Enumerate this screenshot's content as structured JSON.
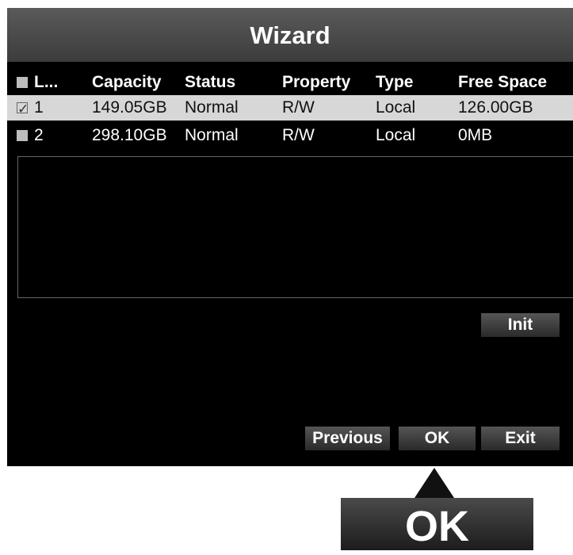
{
  "window": {
    "title": "Wizard"
  },
  "table": {
    "headers": [
      "L...",
      "Capacity",
      "Status",
      "Property",
      "Type",
      "Free Space"
    ],
    "rows": [
      {
        "label": "1",
        "capacity": "149.05GB",
        "status": "Normal",
        "property": "R/W",
        "type": "Local",
        "free_space": "126.00GB",
        "checked": true,
        "selected": true
      },
      {
        "label": "2",
        "capacity": "298.10GB",
        "status": "Normal",
        "property": "R/W",
        "type": "Local",
        "free_space": "0MB",
        "checked": false,
        "selected": false
      }
    ]
  },
  "buttons": {
    "init": "Init",
    "previous": "Previous",
    "ok": "OK",
    "exit": "Exit"
  },
  "callout": {
    "label": "OK"
  },
  "icons": {
    "row_checkbox": "checkbox-icon",
    "checkmark": "checkmark-icon"
  },
  "colors": {
    "selected_row": "#d7d7d7",
    "background": "#000000",
    "titlebar": "#4a4a4a"
  }
}
